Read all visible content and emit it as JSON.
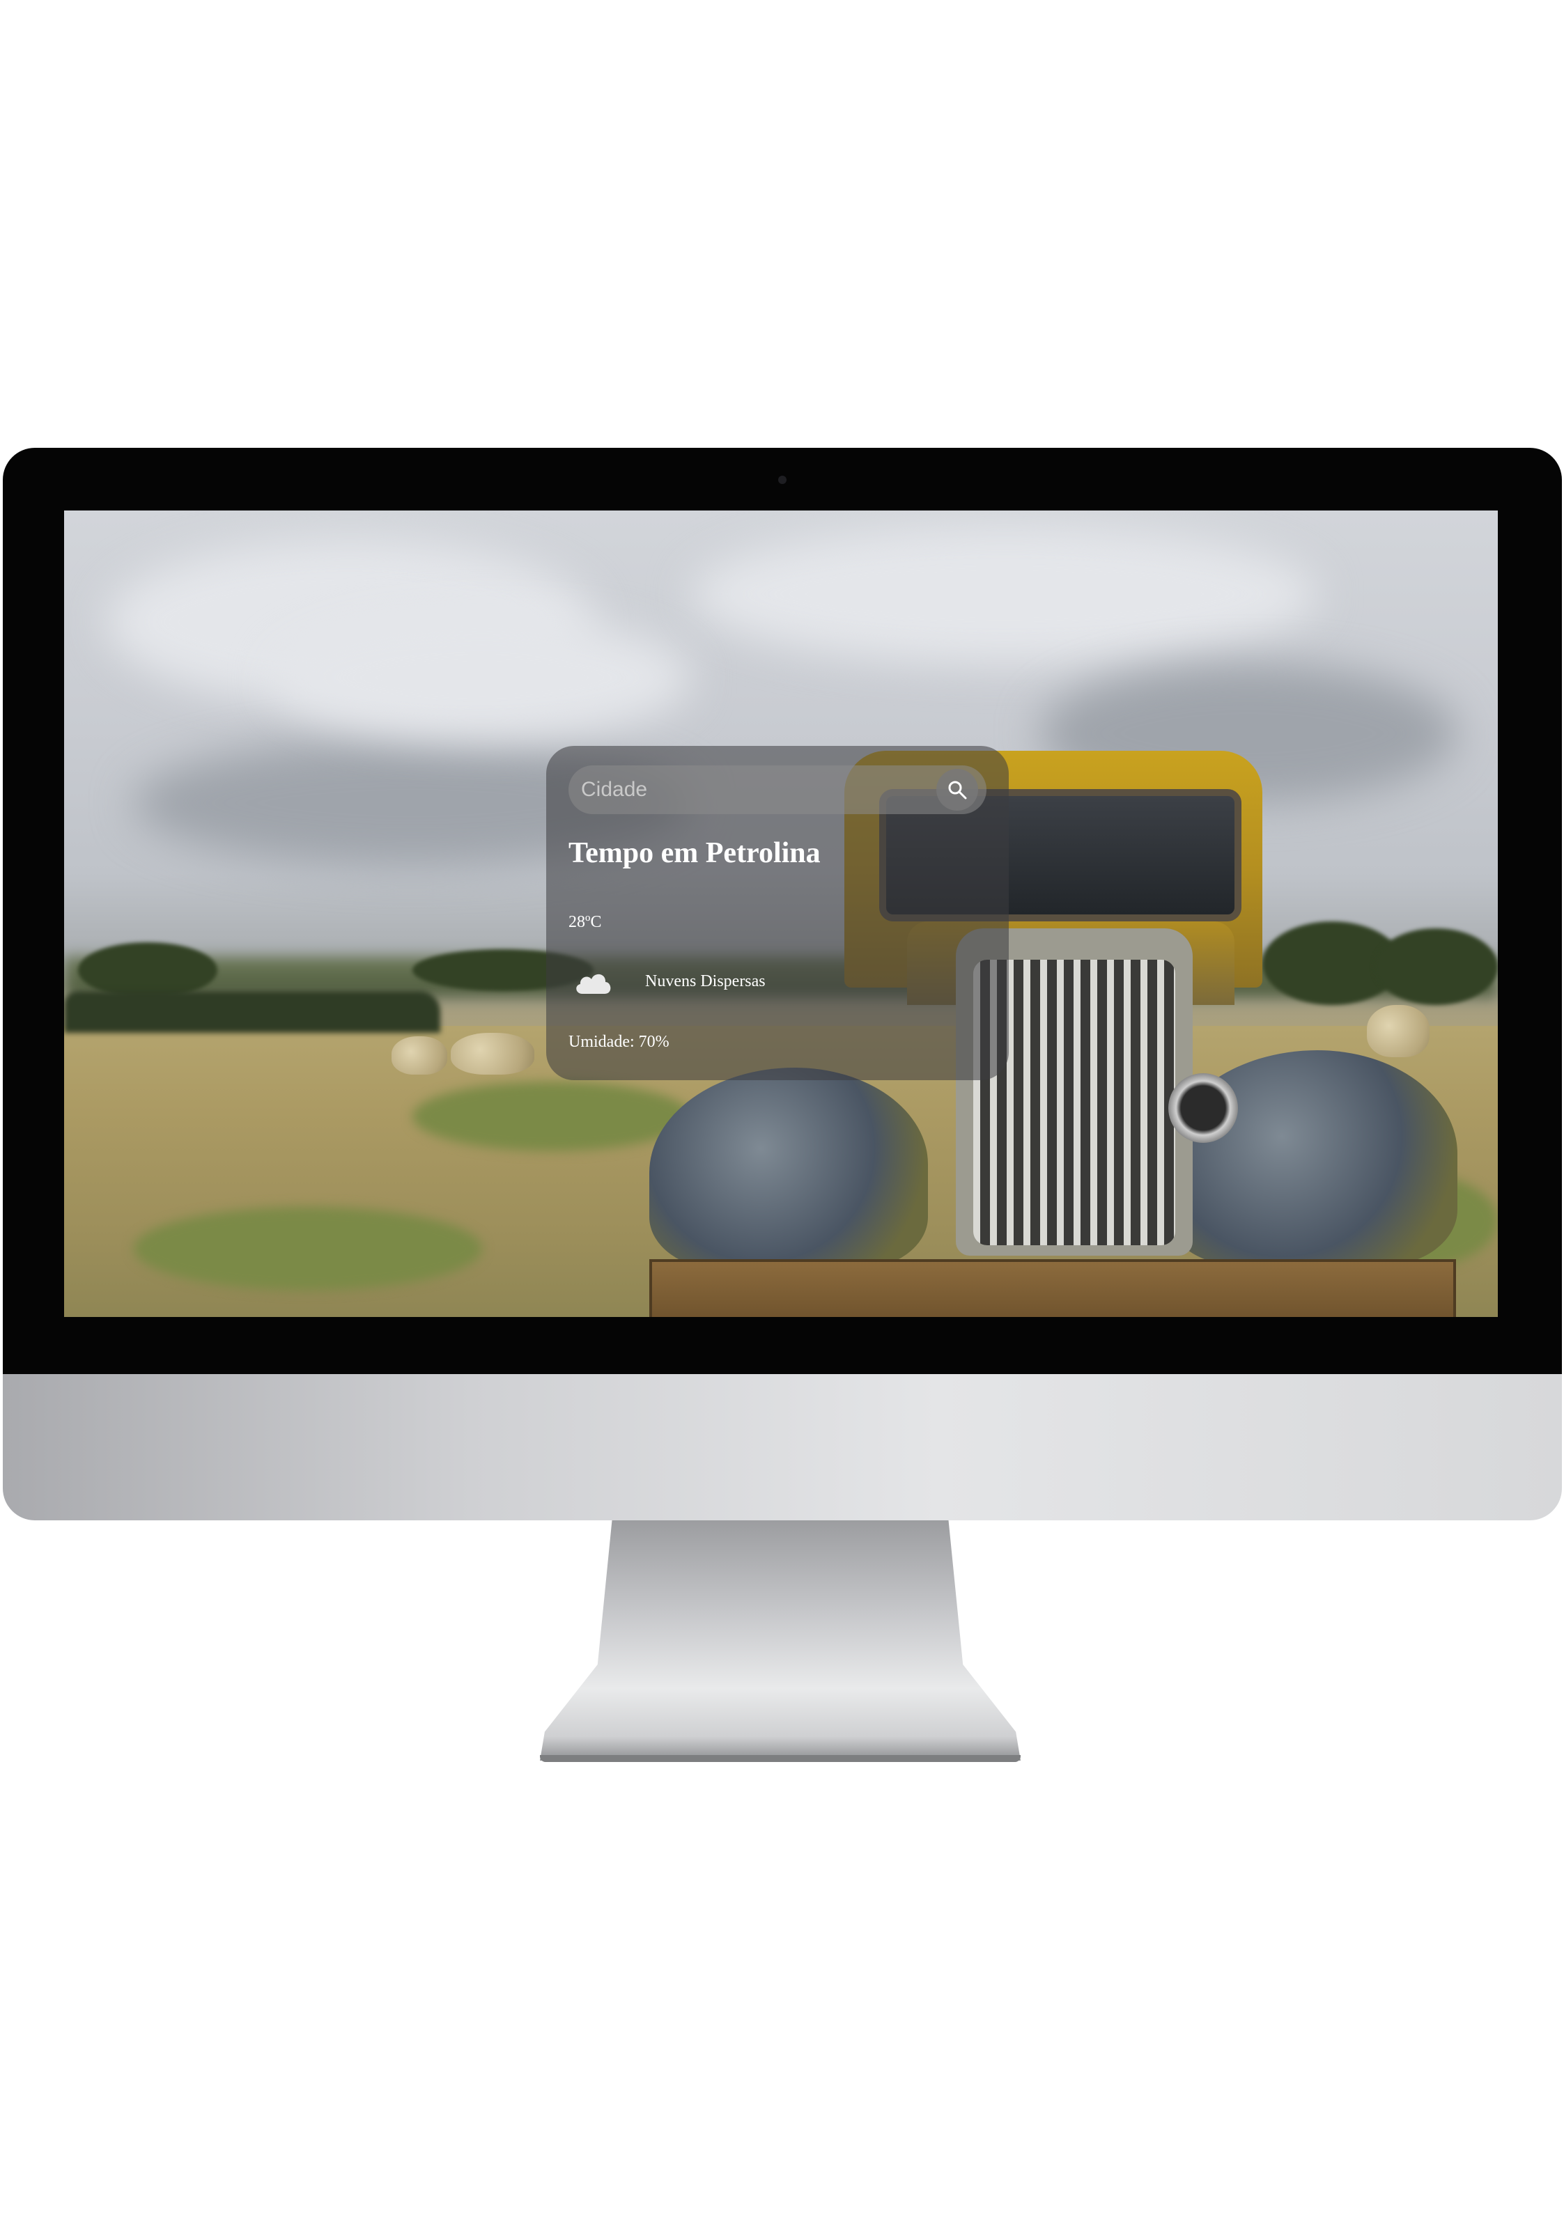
{
  "search": {
    "placeholder": "Cidade"
  },
  "weather": {
    "title": "Tempo em Petrolina",
    "temperature": "28ºC",
    "description": "Nuvens Dispersas",
    "humidity": "Umidade: 70%",
    "icon": "cloud-icon"
  },
  "colors": {
    "card_background": "#3c3c40",
    "text": "#ffffff"
  }
}
